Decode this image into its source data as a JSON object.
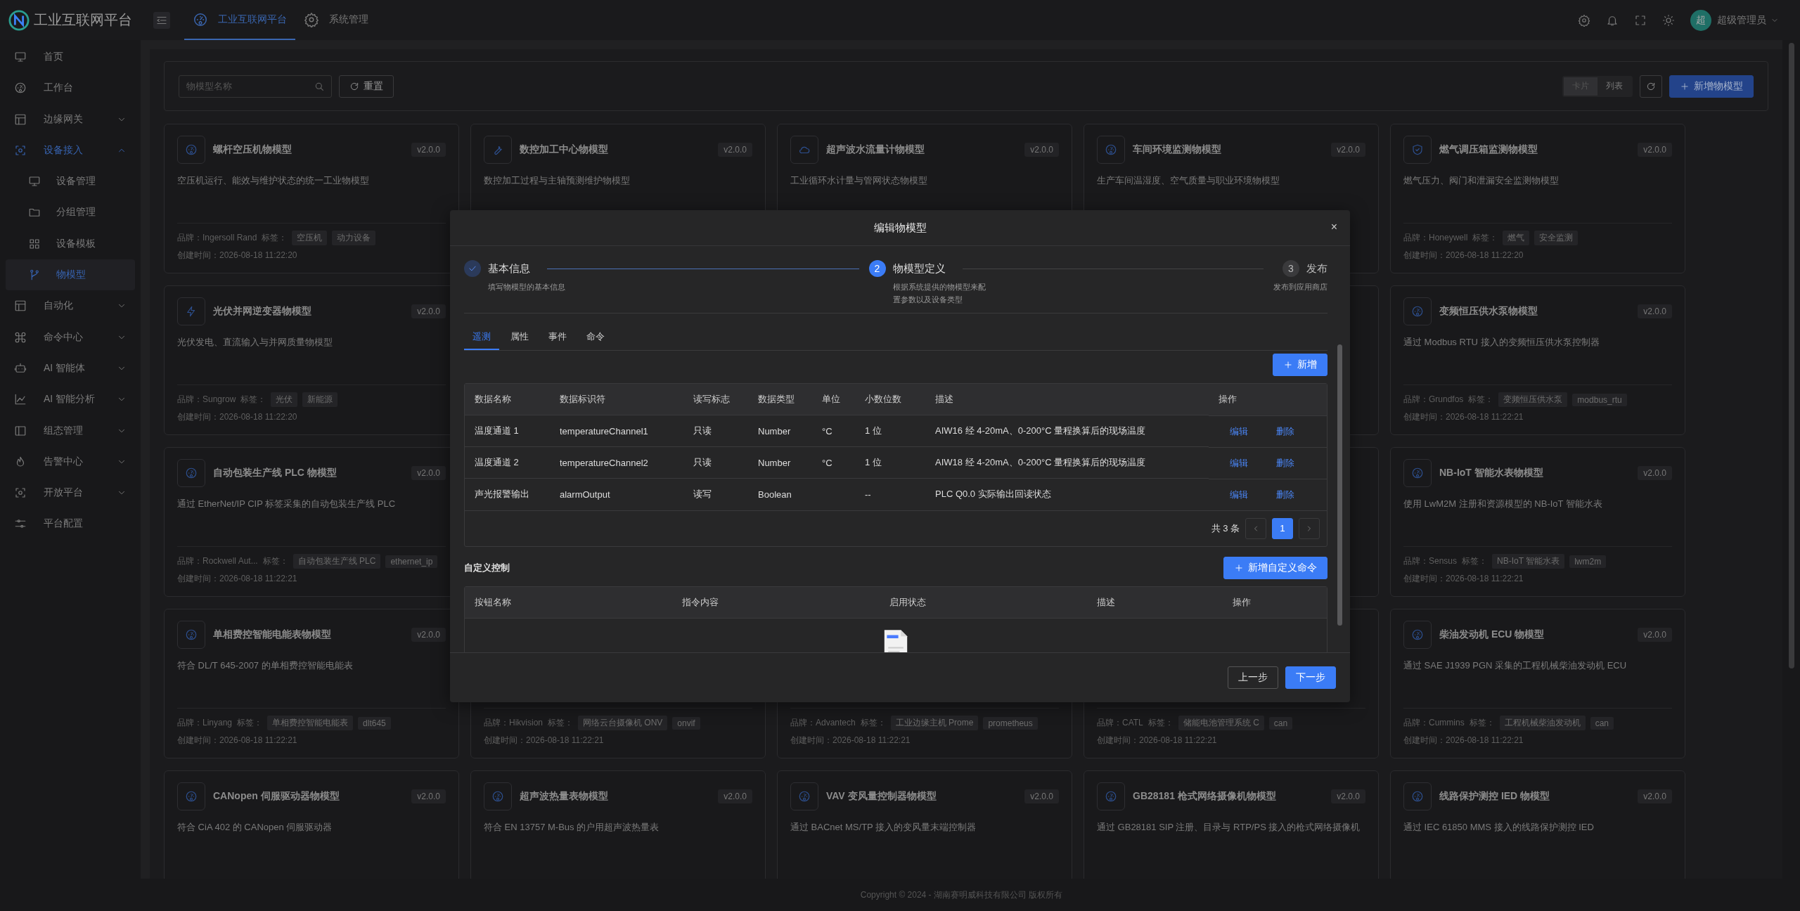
{
  "app": {
    "title": "工业互联网平台"
  },
  "header_tabs": [
    {
      "label": "工业互联网平台",
      "selected": true
    },
    {
      "label": "系统管理",
      "selected": false
    }
  ],
  "user": {
    "avatar": "超",
    "name": "超级管理员"
  },
  "sidebar": {
    "items": [
      {
        "label": "首页",
        "selected": false
      },
      {
        "label": "工作台",
        "selected": false
      },
      {
        "label": "边缘网关",
        "selected": false,
        "expanded": false
      },
      {
        "label": "设备接入",
        "selected": true,
        "expanded": true,
        "children": [
          {
            "label": "设备管理",
            "selected": false
          },
          {
            "label": "分组管理",
            "selected": false
          },
          {
            "label": "设备模板",
            "selected": false
          },
          {
            "label": "物模型",
            "selected": true
          }
        ]
      },
      {
        "label": "自动化",
        "selected": false,
        "expanded": false
      },
      {
        "label": "命令中心",
        "selected": false,
        "expanded": false
      },
      {
        "label": "AI 智能体",
        "selected": false,
        "expanded": false
      },
      {
        "label": "AI 智能分析",
        "selected": false,
        "expanded": false
      },
      {
        "label": "组态管理",
        "selected": false,
        "expanded": false
      },
      {
        "label": "告警中心",
        "selected": false,
        "expanded": false
      },
      {
        "label": "开放平台",
        "selected": false,
        "expanded": false
      },
      {
        "label": "平台配置",
        "selected": false
      }
    ]
  },
  "filter": {
    "search": {
      "placeholder": "物模型名称"
    },
    "reset": "重置",
    "views": [
      {
        "label": "卡片",
        "selected": true
      },
      {
        "label": "列表",
        "selected": false
      }
    ],
    "add": "新增物模型"
  },
  "cards": [
    {
      "title": "螺杆空压机物模型",
      "version": "v2.0.0",
      "description": "空压机运行、能效与维护状态的统一工业物模型",
      "brand": "品牌：Ingersoll Rand",
      "tags_label": "标签：",
      "tags": [
        "空压机",
        "动力设备"
      ],
      "created": "创建时间：2026-08-18 11:22:20"
    },
    {
      "title": "数控加工中心物模型",
      "version": "v2.0.0",
      "description": "数控加工过程与主轴预测维护物模型"
    },
    {
      "title": "超声波水流量计物模型",
      "version": "v2.0.0",
      "description": "工业循环水计量与管网状态物模型"
    },
    {
      "title": "车间环境监测物模型",
      "version": "v2.0.0",
      "description": "生产车间温湿度、空气质量与职业环境物模型"
    },
    {
      "title": "燃气调压箱监测物模型",
      "version": "v2.0.0",
      "description": "燃气压力、阀门和泄漏安全监测物模型",
      "brand": "品牌：Honeywell",
      "tags_label": "标签：",
      "tags": [
        "燃气",
        "安全监测"
      ],
      "created": "创建时间：2026-08-18 11:22:20"
    },
    {
      "title": "光伏并网逆变器物模型",
      "version": "v2.0.0",
      "description": "光伏发电、直流输入与并网质量物模型",
      "brand": "品牌：Sungrow",
      "tags_label": "标签：",
      "tags": [
        "光伏",
        "新能源"
      ],
      "created": "创建时间：2026-08-18 11:22:20"
    },
    {
      "title": "变频恒压供水泵物模型",
      "version": "v2.0.0",
      "description": "通过 Modbus RTU 接入的变频恒压供水泵控制器",
      "brand": "品牌：Grundfos",
      "tags_label": "标签：",
      "tags": [
        "变频恒压供水泵",
        "modbus_rtu"
      ],
      "created": "创建时间：2026-08-18 11:22:21"
    },
    {
      "title": "自动包装生产线 PLC 物模型",
      "version": "v2.0.0",
      "description": "通过 EtherNet/IP CIP 标签采集的自动包装生产线 PLC",
      "brand": "品牌：Rockwell Aut...",
      "tags_label": "标签：",
      "tags": [
        "自动包装生产线 PLC",
        "ethernet_ip"
      ],
      "created": "创建时间：2026-08-18 11:22:21"
    },
    {
      "title": "NB-IoT 智能水表物模型",
      "version": "v2.0.0",
      "description": "使用 LwM2M 注册和资源模型的 NB-IoT 智能水表",
      "brand": "品牌：Sensus",
      "tags_label": "标签：",
      "tags": [
        "NB-IoT 智能水表",
        "lwm2m"
      ],
      "created": "创建时间：2026-08-18 11:22:21"
    },
    {
      "title": "单相费控智能电能表物模型",
      "version": "v2.0.0",
      "description": "符合 DL/T 645-2007 的单相费控智能电能表",
      "brand": "品牌：Linyang",
      "tags_label": "标签：",
      "tags": [
        "单相费控智能电能表",
        "dlt645"
      ],
      "created": "创建时间：2026-08-18 11:22:21"
    },
    {
      "brand": "品牌：Hikvision",
      "tags_label": "标签：",
      "tags": [
        "网络云台摄像机 ONV",
        "onvif"
      ],
      "created": "创建时间：2026-08-18 11:22:21"
    },
    {
      "brand": "品牌：Advantech",
      "tags_label": "标签：",
      "tags": [
        "工业边缘主机 Prome",
        "prometheus"
      ],
      "created": "创建时间：2026-08-18 11:22:21"
    },
    {
      "brand": "品牌：CATL",
      "tags_label": "标签：",
      "tags": [
        "储能电池管理系统 C",
        "can"
      ],
      "created": "创建时间：2026-08-18 11:22:21"
    },
    {
      "title": "柴油发动机 ECU 物模型",
      "version": "v2.0.0",
      "description": "通过 SAE J1939 PGN 采集的工程机械柴油发动机 ECU",
      "brand": "品牌：Cummins",
      "tags_label": "标签：",
      "tags": [
        "工程机械柴油发动机",
        "can"
      ],
      "created": "创建时间：2026-08-18 11:22:21"
    },
    {
      "title": "CANopen 伺服驱动器物模型",
      "version": "v2.0.0",
      "description": "符合 CiA 402 的 CANopen 伺服驱动器"
    },
    {
      "title": "超声波热量表物模型",
      "version": "v2.0.0",
      "description": "符合 EN 13757 M-Bus 的户用超声波热量表"
    },
    {
      "title": "VAV 变风量控制器物模型",
      "version": "v2.0.0",
      "description": "通过 BACnet MS/TP 接入的变风量末端控制器"
    },
    {
      "title": "GB28181 枪式网络摄像机物模型",
      "version": "v2.0.0",
      "description": "通过 GB28181 SIP 注册、目录与 RTP/PS 接入的枪式网络摄像机"
    },
    {
      "title": "线路保护测控 IED 物模型",
      "version": "v2.0.0",
      "description": "通过 IEC 61850 MMS 接入的线路保护测控 IED"
    }
  ],
  "modal": {
    "title": "编辑物模型",
    "close": "×",
    "steps": [
      {
        "title": "基本信息",
        "description": "填写物模型的基本信息",
        "done": true,
        "current": false
      },
      {
        "number": "2",
        "title": "物模型定义",
        "description": "根据系统提供的物模型来配置参数以及设备类型",
        "done": false,
        "current": true
      },
      {
        "number": "3",
        "title": "发布",
        "description": "发布到应用商店",
        "done": false,
        "current": false
      }
    ],
    "tabs": [
      {
        "label": "遥测",
        "selected": true
      },
      {
        "label": "属性",
        "selected": false
      },
      {
        "label": "事件",
        "selected": false
      },
      {
        "label": "命令",
        "selected": false
      }
    ],
    "add": "新增",
    "table": {
      "columns": [
        "数据名称",
        "数据标识符",
        "读写标志",
        "数据类型",
        "单位",
        "小数位数",
        "描述",
        "操作"
      ],
      "rows": [
        {
          "name": "温度通道 1",
          "identifier": "temperatureChannel1",
          "access": "只读",
          "type": "Number",
          "unit": "°C",
          "decimals": "1 位",
          "description": "AIW16 经 4-20mA、0-200°C 量程换算后的现场温度",
          "actions": [
            "编辑",
            "删除"
          ]
        },
        {
          "name": "温度通道 2",
          "identifier": "temperatureChannel2",
          "access": "只读",
          "type": "Number",
          "unit": "°C",
          "decimals": "1 位",
          "description": "AIW18 经 4-20mA、0-200°C 量程换算后的现场温度",
          "actions": [
            "编辑",
            "删除"
          ]
        },
        {
          "name": "声光报警输出",
          "identifier": "alarmOutput",
          "access": "读写",
          "type": "Boolean",
          "decimals": "--",
          "description": "PLC Q0.0 实际输出回读状态",
          "actions": [
            "编辑",
            "删除"
          ]
        }
      ]
    },
    "pagination": {
      "total": "共 3 条",
      "pages": [
        {
          "label": "1",
          "selected": true
        }
      ]
    },
    "custom": {
      "title": "自定义控制",
      "add": "新增自定义命令",
      "columns": [
        "按钮名称",
        "指令内容",
        "启用状态",
        "描述",
        "操作"
      ]
    },
    "buttons": {
      "prev": "上一步",
      "next": "下一步"
    }
  },
  "footer": "Copyright © 2024 - 湖南赛明威科技有限公司 版权所有"
}
